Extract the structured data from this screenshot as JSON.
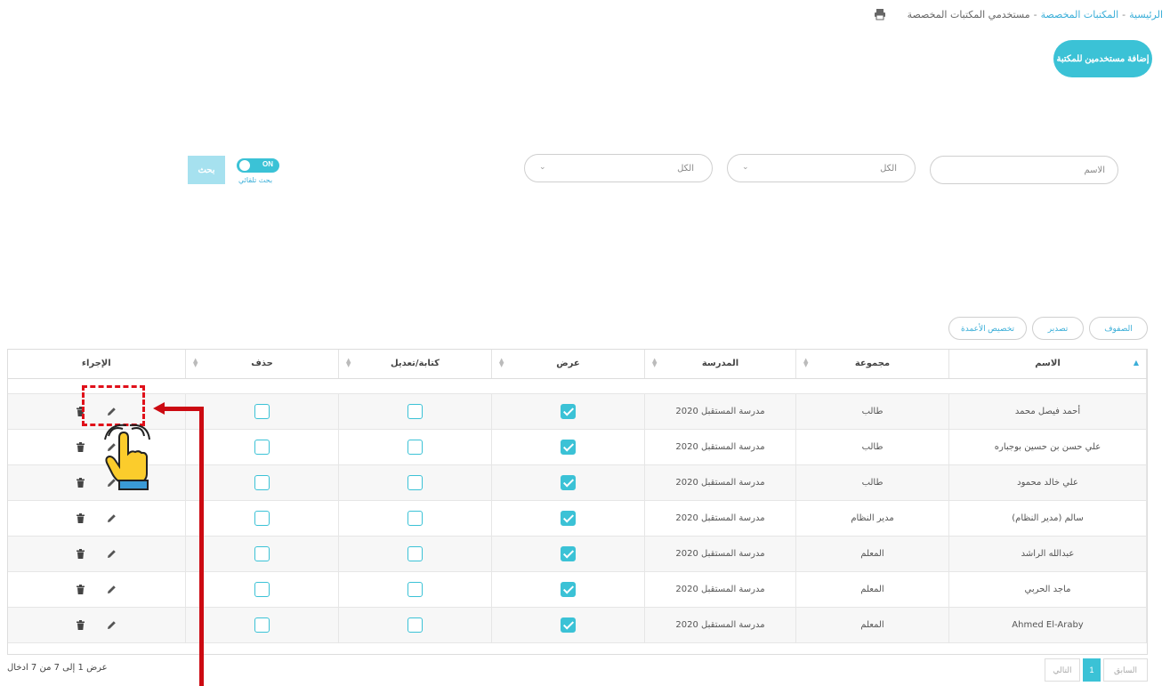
{
  "breadcrumb": {
    "home": "الرئيسية",
    "libraries": "المكتبات المخصصة",
    "current": "مستخدمي المكتبات المخصصة",
    "separator": "-"
  },
  "icons": {
    "print": "print-icon",
    "edit": "pencil-icon",
    "delete": "trash-icon",
    "sort": "sort-icon",
    "chevron": "chevron-down-icon",
    "hand": "pointing-hand-icon"
  },
  "add_button": "إضافة مستخدمين للمكتبة",
  "filters": {
    "name_placeholder": "الاسم",
    "group_select": "الكل",
    "school_select": "الكل",
    "search_button": "بحث",
    "toggle_state": "ON",
    "toggle_label": "بحث تلقائي"
  },
  "table_tools": {
    "rows": "الصفوف",
    "export": "تصدير",
    "columns": "تخصيص الأعمدة"
  },
  "table": {
    "headers": [
      "الاسم",
      "مجموعة",
      "المدرسة",
      "عرض",
      "كتابة/تعديل",
      "حذف",
      "الإجراء"
    ],
    "rows": [
      {
        "name": "أحمد فيصل محمد",
        "group": "طالب",
        "school": "مدرسة المستقبل 2020",
        "view": true,
        "write": false,
        "delete": false
      },
      {
        "name": "علي حسن بن حسين بوجباره",
        "group": "طالب",
        "school": "مدرسة المستقبل 2020",
        "view": true,
        "write": false,
        "delete": false
      },
      {
        "name": "علي خالد محمود",
        "group": "طالب",
        "school": "مدرسة المستقبل 2020",
        "view": true,
        "write": false,
        "delete": false
      },
      {
        "name": "سالم (مدير النظام)",
        "group": "مدير النظام",
        "school": "مدرسة المستقبل 2020",
        "view": true,
        "write": false,
        "delete": false
      },
      {
        "name": "عبدالله الراشد",
        "group": "المعلم",
        "school": "مدرسة المستقبل 2020",
        "view": true,
        "write": false,
        "delete": false
      },
      {
        "name": "ماجد الحربي",
        "group": "المعلم",
        "school": "مدرسة المستقبل 2020",
        "view": true,
        "write": false,
        "delete": false
      },
      {
        "name": "Ahmed El-Araby",
        "group": "المعلم",
        "school": "مدرسة المستقبل 2020",
        "view": true,
        "write": false,
        "delete": false
      }
    ]
  },
  "footer": {
    "info": "عرض 1 إلى 7 من 7 ادخال",
    "prev": "السابق",
    "page": "1",
    "next": "التالي"
  },
  "colors": {
    "accent": "#3bc2d6",
    "annotation": "#cc0a12"
  }
}
